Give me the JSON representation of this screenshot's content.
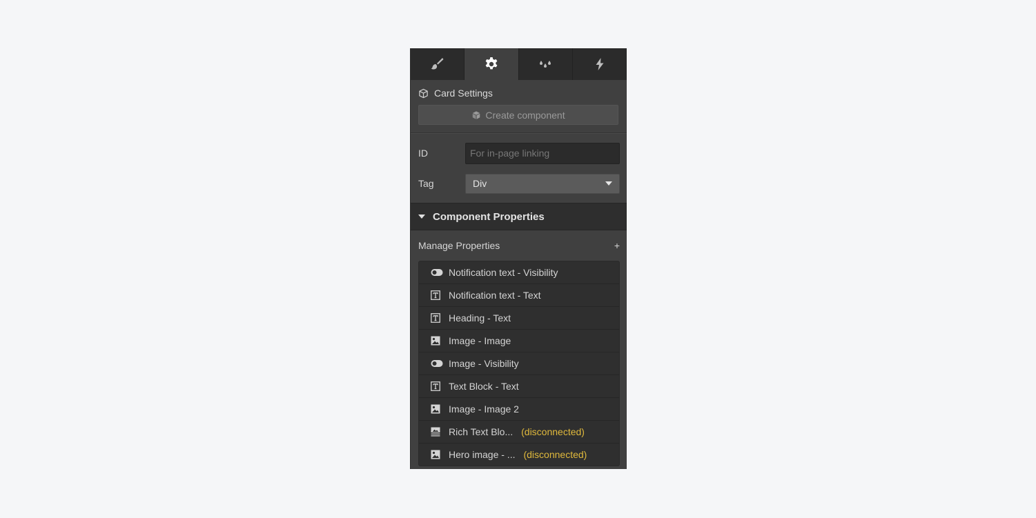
{
  "tabs": [
    {
      "name": "style",
      "icon": "paintbrush-icon",
      "active": false
    },
    {
      "name": "settings",
      "icon": "gear-icon",
      "active": true
    },
    {
      "name": "style-manager",
      "icon": "droplets-icon",
      "active": false
    },
    {
      "name": "interactions",
      "icon": "lightning-icon",
      "active": false
    }
  ],
  "settings": {
    "title": "Card Settings",
    "create_component_label": "Create component"
  },
  "form": {
    "id_label": "ID",
    "id_value": "",
    "id_placeholder": "For in-page linking",
    "tag_label": "Tag",
    "tag_value": "Div"
  },
  "component_properties": {
    "section_title": "Component Properties",
    "manage_label": "Manage Properties",
    "add_symbol": "+",
    "items": [
      {
        "icon": "toggle",
        "label": "Notification text - Visibility",
        "status": ""
      },
      {
        "icon": "text",
        "label": "Notification text - Text",
        "status": ""
      },
      {
        "icon": "text",
        "label": "Heading - Text",
        "status": ""
      },
      {
        "icon": "image",
        "label": "Image - Image",
        "status": ""
      },
      {
        "icon": "toggle",
        "label": "Image - Visibility",
        "status": ""
      },
      {
        "icon": "text",
        "label": "Text Block - Text",
        "status": ""
      },
      {
        "icon": "image",
        "label": "Image - Image 2",
        "status": ""
      },
      {
        "icon": "richtext",
        "label": "Rich Text Blo...",
        "status": "(disconnected)"
      },
      {
        "icon": "image",
        "label": "Hero image - ...",
        "status": "(disconnected)"
      }
    ]
  },
  "colors": {
    "warning": "#e0b93c",
    "panel_bg": "#404040",
    "page_bg": "#f5f6f8"
  }
}
